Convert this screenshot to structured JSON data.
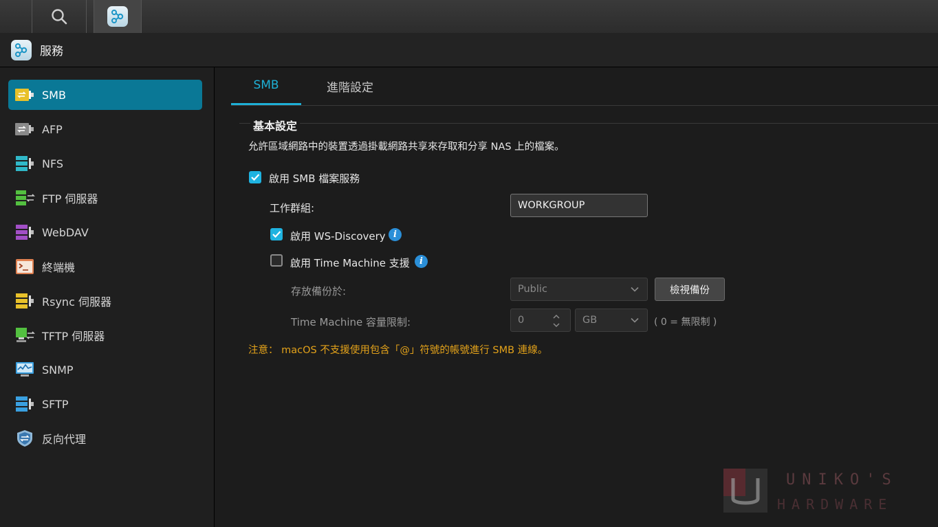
{
  "window": {
    "title": "服務"
  },
  "sidebar": {
    "items": [
      {
        "label": "SMB",
        "icon": "smb-icon",
        "color": "#e8c12a"
      },
      {
        "label": "AFP",
        "icon": "afp-icon",
        "color": "#9a9a9a"
      },
      {
        "label": "NFS",
        "icon": "nfs-icon",
        "color": "#30b8c8"
      },
      {
        "label": "FTP 伺服器",
        "icon": "ftp-server-icon",
        "color": "#53c040"
      },
      {
        "label": "WebDAV",
        "icon": "webdav-icon",
        "color": "#a24fc6"
      },
      {
        "label": "終端機",
        "icon": "terminal-icon",
        "color": "#e08050"
      },
      {
        "label": "Rsync 伺服器",
        "icon": "rsync-server-icon",
        "color": "#e8c12a"
      },
      {
        "label": "TFTP 伺服器",
        "icon": "tftp-server-icon",
        "color": "#53c040"
      },
      {
        "label": "SNMP",
        "icon": "snmp-icon",
        "color": "#3aa0e0"
      },
      {
        "label": "SFTP",
        "icon": "sftp-icon",
        "color": "#3aa0e0"
      },
      {
        "label": "反向代理",
        "icon": "reverse-proxy-icon",
        "color": "#8fb8d8"
      }
    ]
  },
  "tabs": [
    {
      "label": "SMB",
      "active": true
    },
    {
      "label": "進階設定",
      "active": false
    }
  ],
  "section": {
    "title": "基本設定",
    "description": "允許區域網路中的裝置透過掛載網路共享來存取和分享 NAS 上的檔案。"
  },
  "form": {
    "enable_smb": {
      "label": "啟用 SMB 檔案服務",
      "checked": true
    },
    "workgroup": {
      "label": "工作群組:",
      "value": "WORKGROUP"
    },
    "ws_discovery": {
      "label": "啟用 WS-Discovery",
      "checked": true
    },
    "time_machine": {
      "label": "啟用 Time Machine 支援",
      "checked": false
    },
    "backup_location": {
      "label": "存放備份於:",
      "value": "Public",
      "button": "檢視備份"
    },
    "tm_limit": {
      "label": "Time Machine 容量限制:",
      "value": "0",
      "unit": "GB",
      "hint": "( 0 = 無限制 )"
    },
    "note": "注意： macOS 不支援使用包含「@」符號的帳號進行 SMB 連線。"
  },
  "watermark": {
    "line1": "UNIKO'S",
    "line2": "HARDWARE"
  },
  "colors": {
    "accent": "#1eb0d6",
    "selected_bg": "#0a7896",
    "warning": "#e3a21a"
  }
}
